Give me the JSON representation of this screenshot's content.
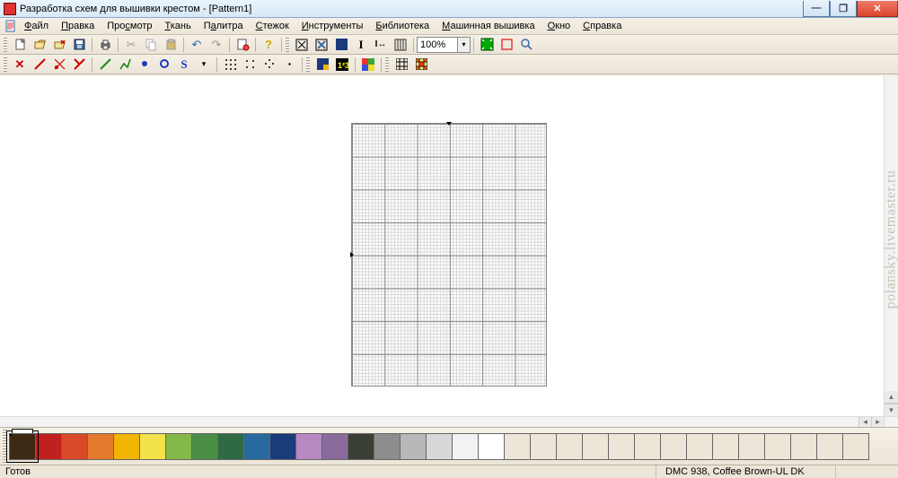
{
  "window": {
    "title": "Разработка схем для вышивки крестом - [Pattern1]"
  },
  "menu": {
    "items": [
      {
        "label": "Файл",
        "u": 0
      },
      {
        "label": "Правка",
        "u": 0
      },
      {
        "label": "Просмотр",
        "u": 3
      },
      {
        "label": "Ткань",
        "u": 0
      },
      {
        "label": "Палитра",
        "u": 1
      },
      {
        "label": "Стежок",
        "u": 0
      },
      {
        "label": "Инструменты",
        "u": 0
      },
      {
        "label": "Библиотека",
        "u": 0
      },
      {
        "label": "Машинная вышивка",
        "u": 0
      },
      {
        "label": "Окно",
        "u": 0
      },
      {
        "label": "Справка",
        "u": 0
      }
    ]
  },
  "toolbar1": {
    "zoom": "100%"
  },
  "palette": {
    "selected_index": 0,
    "colors": [
      "#3d2a14",
      "#c12020",
      "#d94a28",
      "#e47a2e",
      "#f1b400",
      "#f3e24a",
      "#84b84a",
      "#4a8e46",
      "#2f6a43",
      "#286a9d",
      "#1b3c7a",
      "#b788c2",
      "#8a6b9e",
      "#3a3f36",
      "#8d8d8d",
      "#b8b8b8",
      "#d8d8d8",
      "#f2f2f2",
      "#ffffff",
      "",
      "",
      "",
      "",
      "",
      "",
      "",
      "",
      "",
      "",
      "",
      "",
      "",
      ""
    ]
  },
  "statusbar": {
    "ready": "Готов",
    "thread": "DMC  938, Coffee Brown-UL DK"
  },
  "watermark": "polansky.livemaster.ru"
}
